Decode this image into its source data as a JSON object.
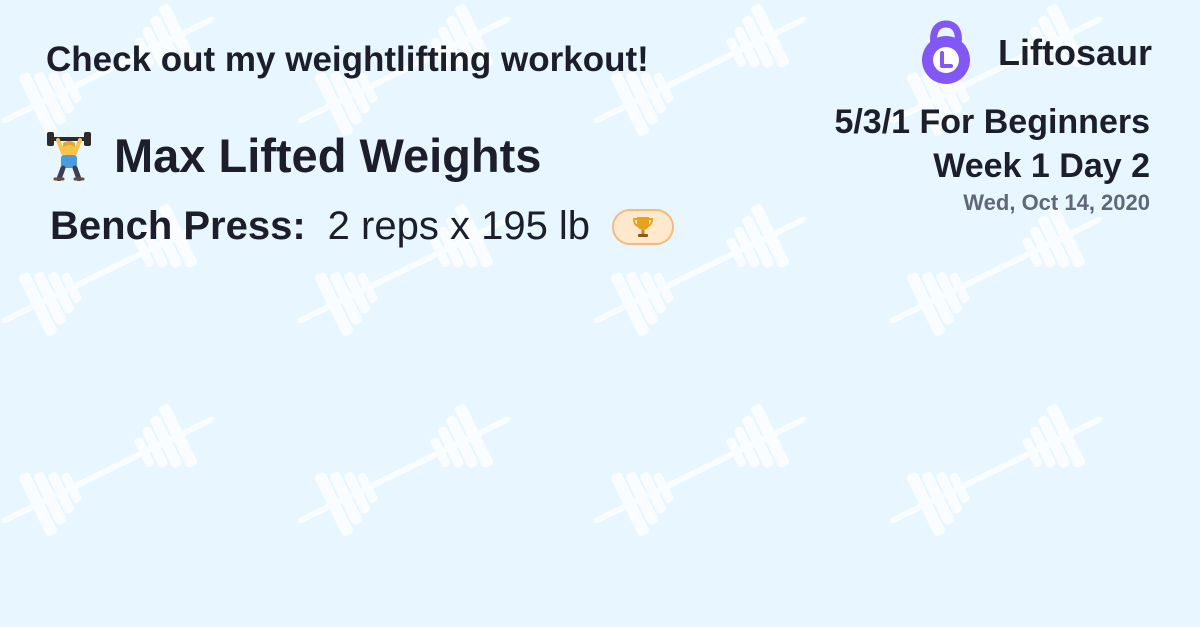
{
  "headline": "Check out my weightlifting workout!",
  "brand": {
    "name": "Liftosaur",
    "logo_letter": "L",
    "logo_color": "#8356f6"
  },
  "program": {
    "name": "5/3/1 For Beginners",
    "day": "Week 1 Day 2",
    "date": "Wed, Oct 14, 2020"
  },
  "section": {
    "icon": "weightlifter-icon",
    "title": "Max Lifted Weights"
  },
  "records": [
    {
      "exercise": "Bench Press:",
      "value": "2 reps x 195 lb",
      "badge_icon": "trophy-icon"
    }
  ],
  "colors": {
    "background": "#e8f6ff",
    "pattern": "#ffffff",
    "text": "#1c1f2b",
    "date_text": "#5f6778",
    "badge_bg": "#ffe9cc",
    "badge_border": "#f2bb7c"
  }
}
